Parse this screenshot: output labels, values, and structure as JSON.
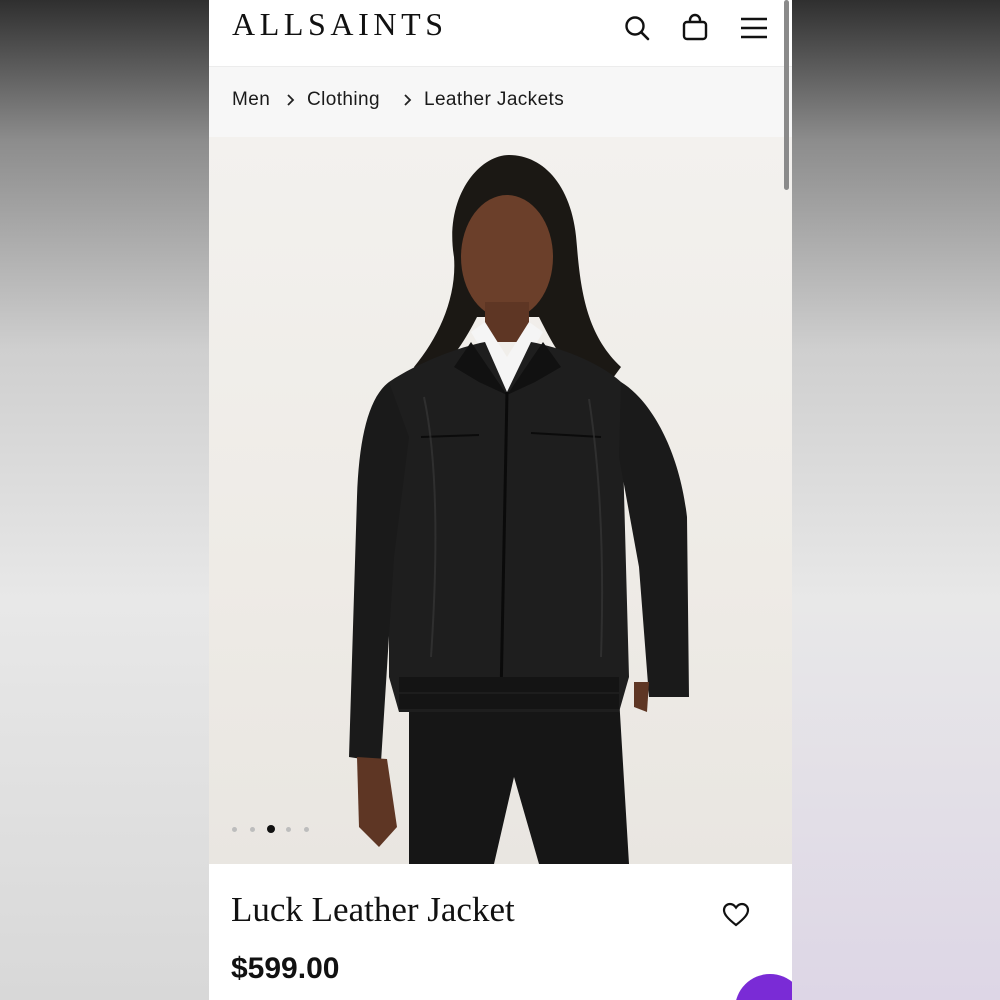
{
  "header": {
    "logo": "ALLSAINTS",
    "icons": [
      "search-icon",
      "shopping-bag-icon",
      "menu-icon"
    ]
  },
  "breadcrumb": {
    "items": [
      {
        "label": "Men"
      },
      {
        "label": "Clothing"
      },
      {
        "label": "Leather Jackets"
      }
    ],
    "separator_icon": "chevron-right-icon"
  },
  "gallery": {
    "total_images": 5,
    "active_index": 3
  },
  "product": {
    "title": "Luck Leather Jacket",
    "price": "$599.00",
    "wishlist_icon": "heart-icon"
  },
  "colors": {
    "text": "#111111",
    "breadcrumb_bg": "#f7f7f7",
    "chat_accent": "#7a2bd6"
  }
}
